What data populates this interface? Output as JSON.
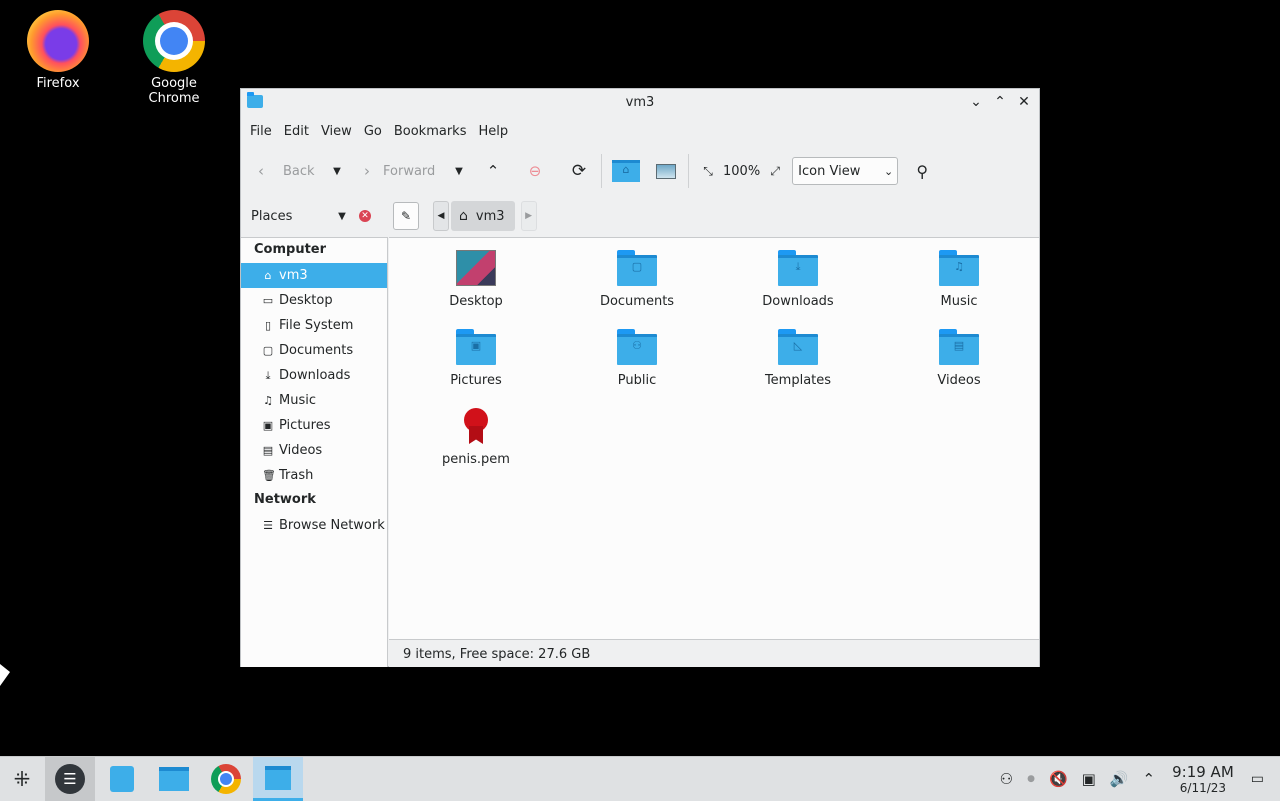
{
  "desktop": {
    "icons": [
      {
        "label": "Firefox",
        "icon": "firefox-icon"
      },
      {
        "label": "Google Chrome",
        "icon": "chrome-icon"
      }
    ]
  },
  "window": {
    "title": "vm3",
    "menu": [
      "File",
      "Edit",
      "View",
      "Go",
      "Bookmarks",
      "Help"
    ],
    "toolbar": {
      "back_label": "Back",
      "forward_label": "Forward",
      "zoom": "100%",
      "view_mode": "Icon View"
    },
    "places_header": "Places",
    "breadcrumb": "vm3",
    "places": {
      "computer_label": "Computer",
      "computer_items": [
        {
          "label": "vm3",
          "icon": "home-icon",
          "glyph": "⌂",
          "selected": true
        },
        {
          "label": "Desktop",
          "icon": "desktop-icon",
          "glyph": "▭"
        },
        {
          "label": "File System",
          "icon": "drive-icon",
          "glyph": "▯"
        },
        {
          "label": "Documents",
          "icon": "document-icon",
          "glyph": "▢"
        },
        {
          "label": "Downloads",
          "icon": "download-icon",
          "glyph": "⤓"
        },
        {
          "label": "Music",
          "icon": "music-icon",
          "glyph": "♫"
        },
        {
          "label": "Pictures",
          "icon": "picture-icon",
          "glyph": "▣"
        },
        {
          "label": "Videos",
          "icon": "video-icon",
          "glyph": "▤"
        },
        {
          "label": "Trash",
          "icon": "trash-icon",
          "glyph": "🗑"
        }
      ],
      "network_label": "Network",
      "network_items": [
        {
          "label": "Browse Network",
          "icon": "network-icon",
          "glyph": "☰"
        }
      ]
    },
    "files": [
      {
        "name": "Desktop",
        "type": "desktop"
      },
      {
        "name": "Documents",
        "type": "folder",
        "glyph": "▢"
      },
      {
        "name": "Downloads",
        "type": "folder",
        "glyph": "⤓"
      },
      {
        "name": "Music",
        "type": "folder",
        "glyph": "♫"
      },
      {
        "name": "Pictures",
        "type": "folder",
        "glyph": "▣"
      },
      {
        "name": "Public",
        "type": "folder",
        "glyph": "⚇"
      },
      {
        "name": "Templates",
        "type": "folder",
        "glyph": "◺"
      },
      {
        "name": "Videos",
        "type": "folder",
        "glyph": "▤"
      },
      {
        "name": "penis.pem",
        "type": "certificate"
      }
    ],
    "status": "9 items, Free space: 27.6 GB"
  },
  "taskbar": {
    "clock_time": "9:19 AM",
    "clock_date": "6/11/23"
  }
}
